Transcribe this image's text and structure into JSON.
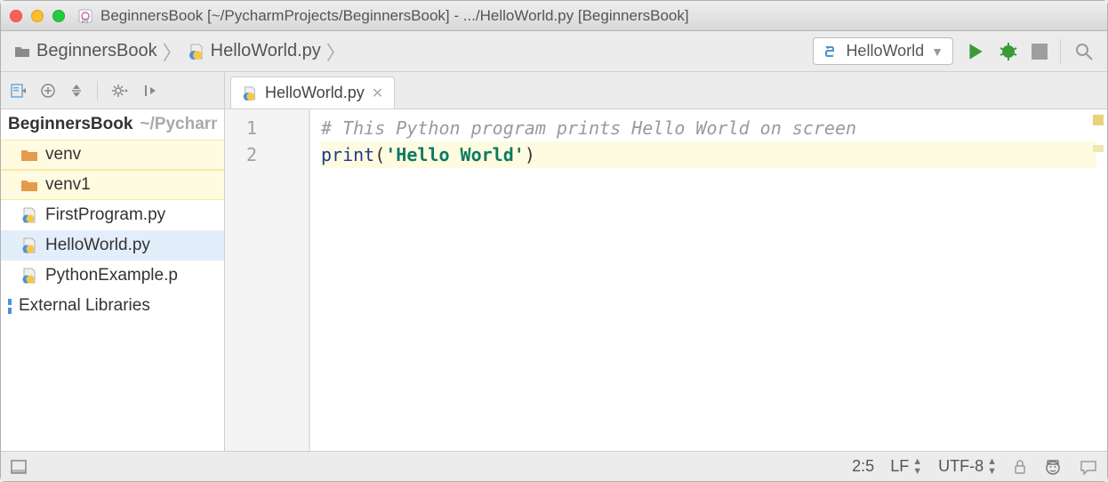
{
  "window": {
    "title": "BeginnersBook [~/PycharmProjects/BeginnersBook] - .../HelloWorld.py [BeginnersBook]"
  },
  "breadcrumbs": {
    "items": [
      {
        "label": "BeginnersBook"
      },
      {
        "label": "HelloWorld.py"
      }
    ]
  },
  "run_config": {
    "selected": "HelloWorld"
  },
  "tabs": [
    {
      "label": "HelloWorld.py"
    }
  ],
  "tree": {
    "root": {
      "name": "BeginnersBook",
      "suffix": "~/PycharmProjects/BeginnersBook"
    },
    "items": [
      {
        "name": "venv",
        "kind": "folder"
      },
      {
        "name": "venv1",
        "kind": "folder"
      },
      {
        "name": "FirstProgram.py",
        "kind": "pyfile"
      },
      {
        "name": "HelloWorld.py",
        "kind": "pyfile",
        "selected": true
      },
      {
        "name": "PythonExample.py",
        "kind": "pyfile",
        "truncated": "PythonExample.p"
      }
    ],
    "external": "External Libraries"
  },
  "editor": {
    "lines": {
      "l1_number": "1",
      "l2_number": "2",
      "comment": "# This Python program prints Hello World on screen",
      "print_kw": "print",
      "open_paren": "(",
      "string": "'Hello World'",
      "close_paren": ")"
    }
  },
  "status": {
    "caret": "2:5",
    "line_sep": "LF",
    "encoding": "UTF-8"
  }
}
